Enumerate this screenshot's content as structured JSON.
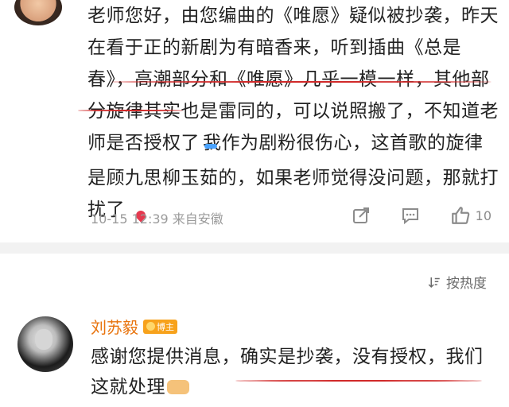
{
  "comment1": {
    "text_parts": [
      "老师您好，由您编曲的《唯愿》疑似被抄袭，昨天在看于正的新剧为有暗香来，听到插曲《总是春》，高潮部分和《唯愿》几乎一模一样，其他部分旋律其实也是雷同的，可以说照搬了，不知道老师是否授权了",
      "我作为剧粉很伤心，这首歌的旋律是顾九思柳玉茹的，如果老师觉得没问题，那就打扰了"
    ],
    "emojis": [
      "crying-emoji",
      "shy-heart-emoji"
    ],
    "meta": "10-15 12:39 来自安徽",
    "actions": {
      "like_count": "10"
    }
  },
  "sort": {
    "label": "按热度"
  },
  "comment2": {
    "username": "刘苏毅",
    "badge": "博主",
    "text": "感谢您提供消息，确实是抄袭，没有授权，我们这就处理",
    "emoji": "handshake-emoji"
  },
  "colors": {
    "username": "#e8730c",
    "underline": "#d12a2a",
    "badge": "#f7a21c"
  }
}
